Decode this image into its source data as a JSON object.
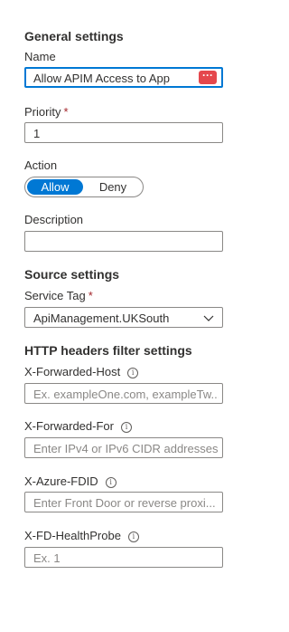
{
  "general": {
    "section_title": "General settings",
    "name_label": "Name",
    "name_value": "Allow APIM Access to App",
    "priority_label": "Priority",
    "required_mark": "*",
    "priority_value": "1",
    "action_label": "Action",
    "action_allow": "Allow",
    "action_deny": "Deny",
    "description_label": "Description",
    "description_value": ""
  },
  "source": {
    "section_title": "Source settings",
    "service_tag_label": "Service Tag",
    "service_tag_value": "ApiManagement.UKSouth"
  },
  "http_filters": {
    "section_title": "HTTP headers filter settings",
    "forwarded_host_label": "X-Forwarded-Host",
    "forwarded_host_placeholder": "Ex. exampleOne.com, exampleTw...",
    "forwarded_for_label": "X-Forwarded-For",
    "forwarded_for_placeholder": "Enter IPv4 or IPv6 CIDR addresses.",
    "azure_fdid_label": "X-Azure-FDID",
    "azure_fdid_placeholder": "Enter Front Door or reverse proxi...",
    "health_probe_label": "X-FD-HealthProbe",
    "health_probe_placeholder": "Ex. 1"
  },
  "icons": {
    "info": "info-icon",
    "ellipsis": "more-options-icon",
    "dropdown": "chevron-down-icon"
  },
  "colors": {
    "accent": "#0078d4",
    "required": "#a4262c",
    "ellipsis_bg": "#e5484d"
  }
}
